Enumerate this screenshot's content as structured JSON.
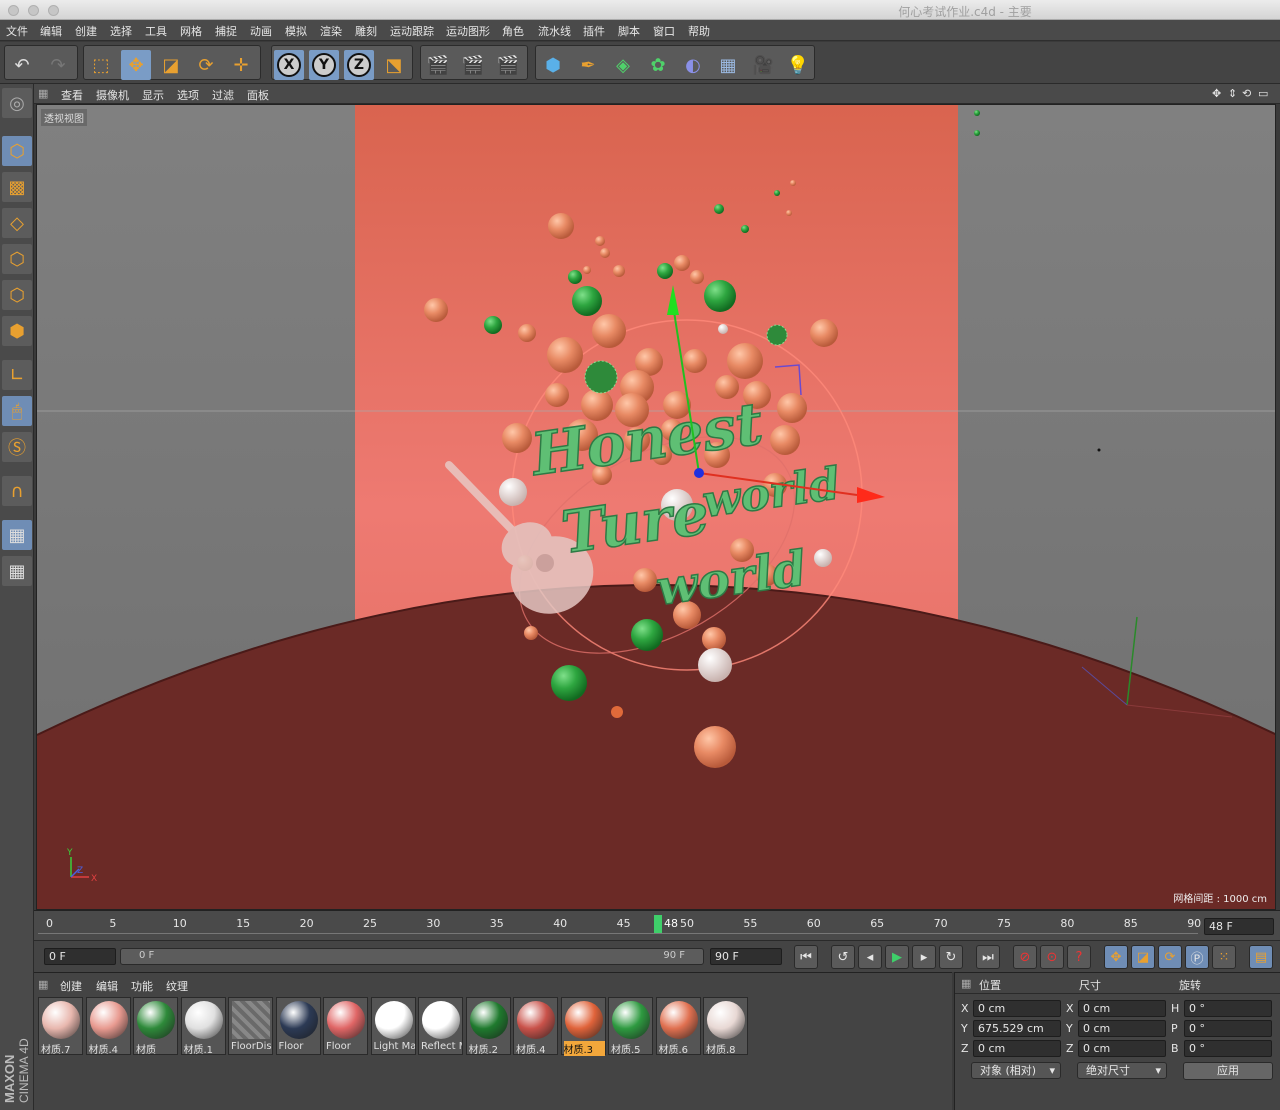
{
  "window": {
    "title": "何心考试作业.c4d - 主要"
  },
  "menu": [
    "文件",
    "编辑",
    "创建",
    "选择",
    "工具",
    "网格",
    "捕捉",
    "动画",
    "模拟",
    "渲染",
    "雕刻",
    "运动跟踪",
    "运动图形",
    "角色",
    "流水线",
    "插件",
    "脚本",
    "窗口",
    "帮助"
  ],
  "toolbar": {
    "axes": [
      "X",
      "Y",
      "Z"
    ]
  },
  "viewport": {
    "menu": [
      "查看",
      "摄像机",
      "显示",
      "选项",
      "过滤",
      "面板"
    ],
    "label": "透视视图",
    "grid_spacing": "网格间距 : 1000 cm",
    "scene_text": [
      "Honest",
      "world",
      "Ture",
      "world"
    ],
    "axis_labels": {
      "y": "Y",
      "z": "Z",
      "x": "X"
    }
  },
  "timeline": {
    "ticks": [
      "0",
      "5",
      "10",
      "15",
      "20",
      "25",
      "30",
      "35",
      "40",
      "45",
      "50",
      "55",
      "60",
      "65",
      "70",
      "75",
      "80",
      "85",
      "90"
    ],
    "current_frame": "48",
    "frame_field": "48 F"
  },
  "transport": {
    "start": "0 F",
    "range_start": "0 F",
    "range_end": "90 F",
    "end": "90 F"
  },
  "materials": {
    "menu": [
      "创建",
      "编辑",
      "功能",
      "纹理"
    ],
    "items": [
      {
        "name": "材质.7",
        "color": "#e8b7ae"
      },
      {
        "name": "材质.4",
        "color": "#e89a90"
      },
      {
        "name": "材质",
        "color": "#2e8a3a"
      },
      {
        "name": "材质.1",
        "color": "#e0e0e0"
      },
      {
        "name": "FloorDis",
        "color": "#777777"
      },
      {
        "name": "Floor",
        "color": "#2c3a55"
      },
      {
        "name": "Floor",
        "color": "#e06666"
      },
      {
        "name": "Light Ma",
        "color": "#ffffff"
      },
      {
        "name": "Reflect M",
        "color": "#ffffff"
      },
      {
        "name": "材质.2",
        "color": "#1f7a2e"
      },
      {
        "name": "材质.4",
        "color": "#c9524a"
      },
      {
        "name": "材质.3",
        "color": "#e0633a"
      },
      {
        "name": "材质.5",
        "color": "#2e9a40"
      },
      {
        "name": "材质.6",
        "color": "#e07050"
      },
      {
        "name": "材质.8",
        "color": "#e8d8d4"
      }
    ],
    "active_index": 11
  },
  "coordinates": {
    "headers": {
      "position": "位置",
      "size": "尺寸",
      "rotation": "旋转"
    },
    "rows": [
      {
        "axis": "X",
        "pos": "0 cm",
        "size_axis": "X",
        "size": "0 cm",
        "rot_axis": "H",
        "rot": "0 °"
      },
      {
        "axis": "Y",
        "pos": "675.529 cm",
        "size_axis": "Y",
        "size": "0 cm",
        "rot_axis": "P",
        "rot": "0 °"
      },
      {
        "axis": "Z",
        "pos": "0 cm",
        "size_axis": "Z",
        "size": "0 cm",
        "rot_axis": "B",
        "rot": "0 °"
      }
    ],
    "mode": "对象 (相对)",
    "size_mode": "绝对尺寸",
    "apply": "应用"
  },
  "brand": {
    "maxon": "MAXON",
    "product": "CINEMA 4D"
  }
}
